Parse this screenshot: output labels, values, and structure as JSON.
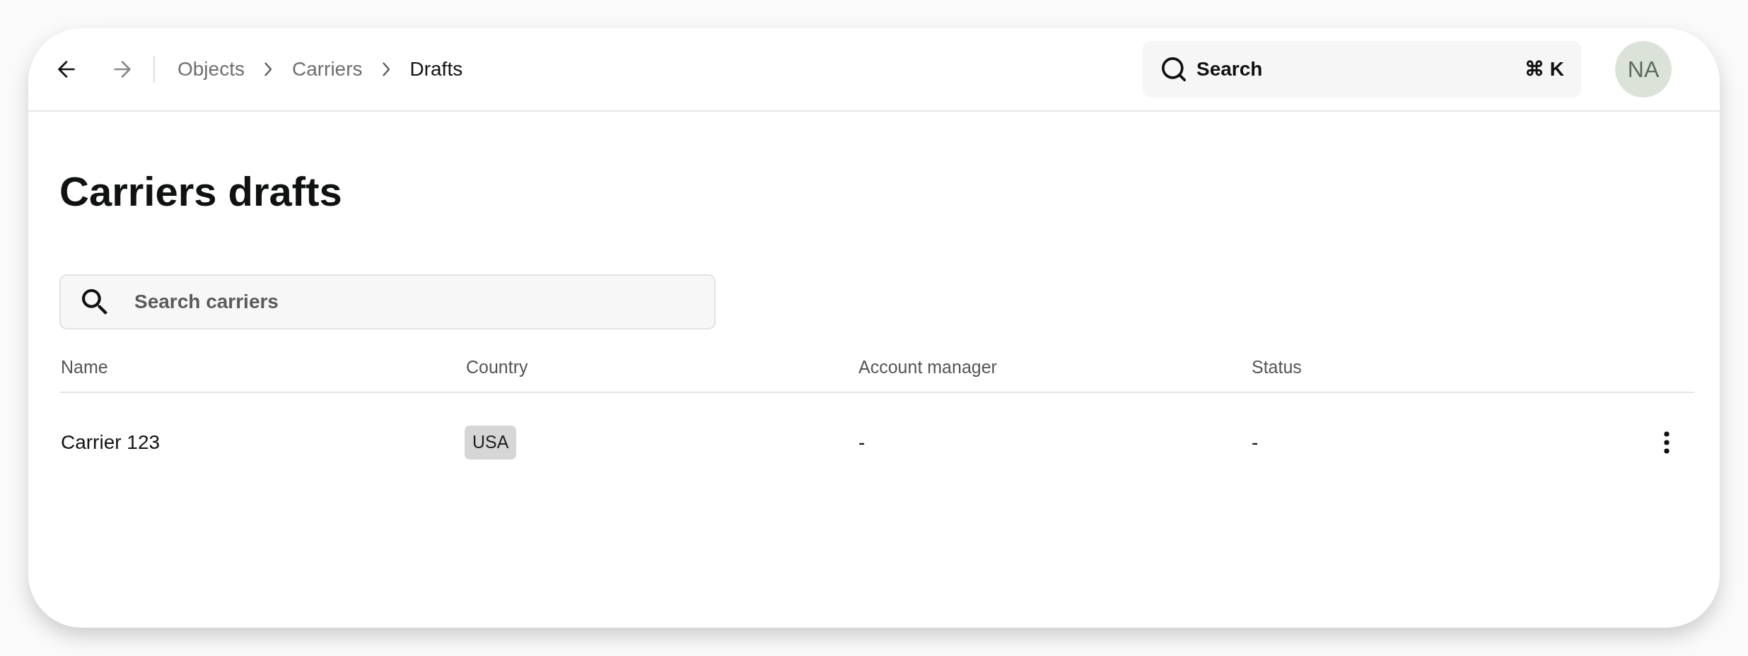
{
  "nav_buttons": [
    {
      "kind": "back",
      "disabled": false
    },
    {
      "kind": "forward",
      "disabled": true
    }
  ],
  "breadcrumbs": [
    {
      "label": "Objects",
      "current": false
    },
    {
      "label": "Carriers",
      "current": false
    },
    {
      "label": "Drafts",
      "current": true
    }
  ],
  "search": {
    "label": "Search",
    "shortcut": "⌘ K"
  },
  "avatar": {
    "initials": "NA"
  },
  "page": {
    "title": "Carriers drafts"
  },
  "filter": {
    "placeholder": "Search carriers"
  },
  "table": {
    "columns": [
      "Name",
      "Country",
      "Account manager",
      "Status"
    ],
    "rows": [
      {
        "cells": [
          {
            "kind": "text",
            "value": "Carrier 123"
          },
          {
            "kind": "tag",
            "value": "USA"
          },
          {
            "kind": "text",
            "value": "-"
          },
          {
            "kind": "text",
            "value": "-"
          }
        ]
      }
    ]
  }
}
